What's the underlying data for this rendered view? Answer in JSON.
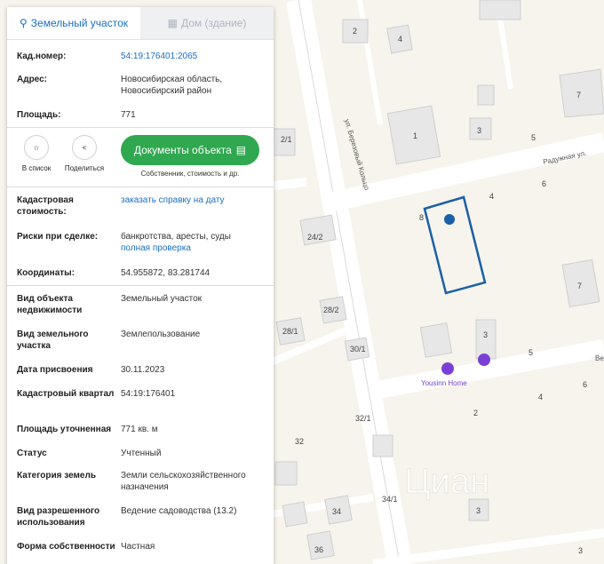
{
  "tabs": {
    "land": "Земельный участок",
    "house": "Дом (здание)"
  },
  "colors": {
    "accent": "#1a6fc4",
    "green": "#2fa84f",
    "parcel": "#1b5fa8"
  },
  "info_top": [
    {
      "label": "Кад.номер:",
      "value": "54:19:176401:2065",
      "link": true
    },
    {
      "label": "Адрес:",
      "value": "Новосибирская область, Новосибирский район"
    },
    {
      "label": "Площадь:",
      "value": "771"
    }
  ],
  "actions": {
    "fav": "В список",
    "share": "Поделиться",
    "docs": "Документы объекта",
    "docs_sub": "Собственник, стоимость и др."
  },
  "info_mid": [
    {
      "label": "Кадастровая стоимость:",
      "value": "заказать справку на дату",
      "link": true
    },
    {
      "label": "Риски при сделке:",
      "value": "банкротства, аресты, суды",
      "extra": "полная проверка"
    },
    {
      "label": "Координаты:",
      "value": "54.955872, 83.281744"
    }
  ],
  "info_bottom": [
    {
      "label": "Вид объекта недвижимости",
      "value": "Земельный участок"
    },
    {
      "label": "Вид земельного участка",
      "value": "Землепользование"
    },
    {
      "label": "Дата присвоения",
      "value": "30.11.2023"
    },
    {
      "label": "Кадастровый квартал",
      "value": "54:19:176401"
    },
    {
      "label": "Площадь уточненная",
      "value": "771 кв. м"
    },
    {
      "label": "Статус",
      "value": "Учтенный"
    },
    {
      "label": "Категория земель",
      "value": "Земли сельскохозяйственного назначения"
    },
    {
      "label": "Вид разрешенного использования",
      "value": "Ведение садоводства (13.2)"
    },
    {
      "label": "Форма собственности",
      "value": "Частная"
    }
  ],
  "map": {
    "streets": {
      "berez": "ул. Березовый Кольцо",
      "radug": "Радужная ул.",
      "ve": "Ве"
    },
    "poi": "Yousinn Home",
    "watermark": "Циан",
    "numbers": [
      "2",
      "4",
      "7",
      "1",
      "3",
      "5",
      "6",
      "4",
      "2/1",
      "24/2",
      "7",
      "28/2",
      "28/1",
      "30/1",
      "3",
      "5",
      "4",
      "6",
      "2",
      "32/1",
      "32",
      "34",
      "34/1",
      "36",
      "3",
      "3",
      "8"
    ]
  }
}
